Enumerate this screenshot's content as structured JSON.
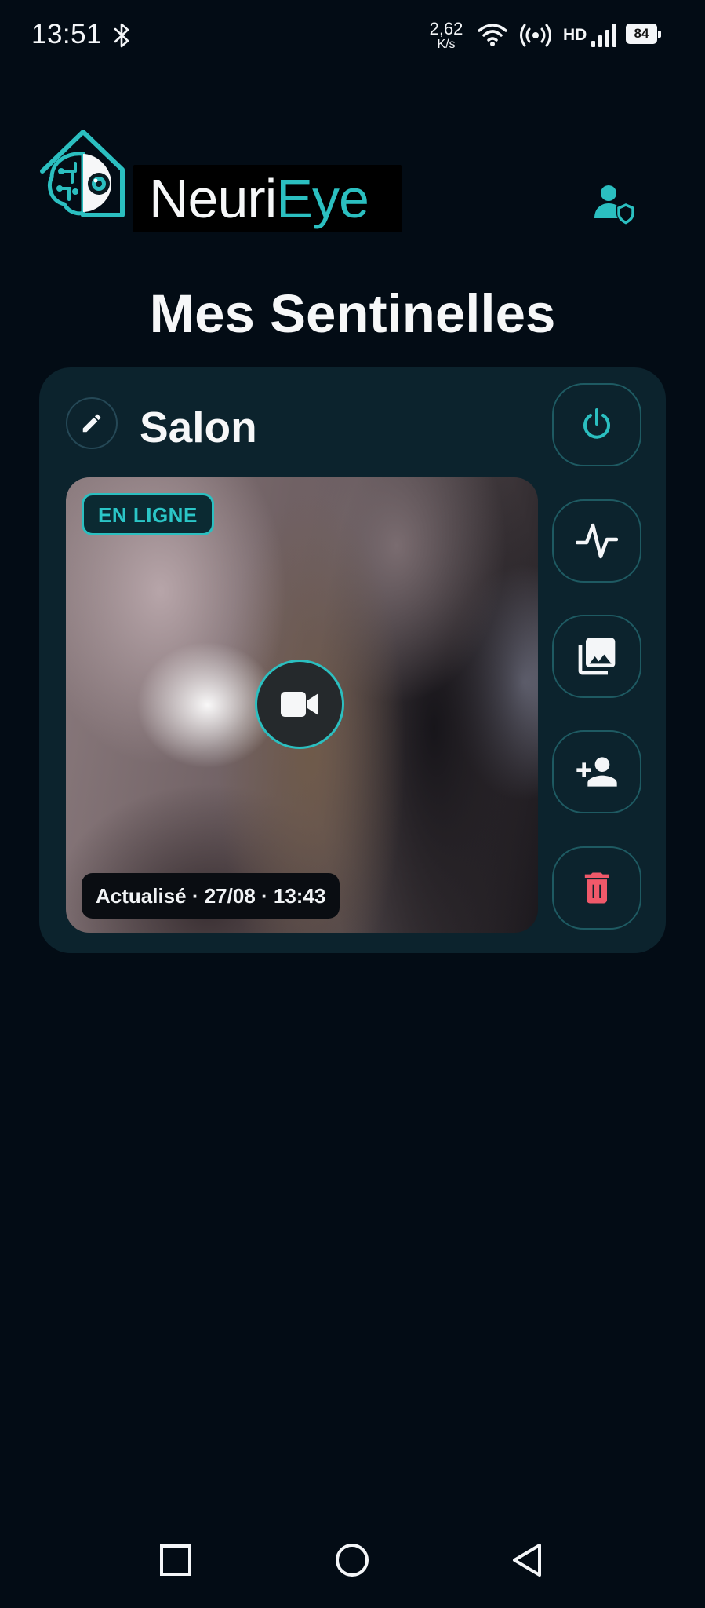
{
  "status_bar": {
    "time": "13:51",
    "net_speed_value": "2,62",
    "net_speed_unit": "K/s",
    "network_label": "HD",
    "battery_level": "84"
  },
  "header": {
    "brand_part1": "Neuri",
    "brand_part2": "Eye"
  },
  "page": {
    "title": "Mes Sentinelles"
  },
  "card": {
    "name": "Salon",
    "status": "EN LIGNE",
    "updated": "Actualisé · 27/08 · 13:43"
  },
  "icons": {
    "bluetooth": "bluetooth-icon",
    "wifi": "wifi-icon",
    "hotspot": "hotspot-icon",
    "signal": "signal-icon",
    "account": "account-shield-icon",
    "edit": "pencil-icon",
    "power": "power-icon",
    "activity": "activity-icon",
    "gallery": "gallery-icon",
    "add_user": "add-user-icon",
    "delete": "trash-icon",
    "video": "video-camera-icon"
  },
  "colors": {
    "background": "#030c15",
    "card": "#0c232d",
    "accent": "#2bbfc0",
    "danger": "#f0596a"
  }
}
